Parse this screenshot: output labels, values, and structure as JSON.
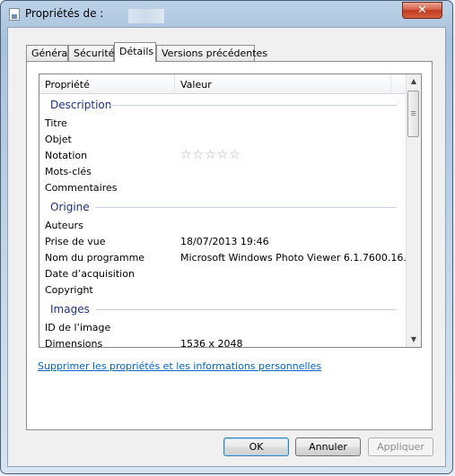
{
  "window": {
    "title": "Propriétés de :"
  },
  "tabs": [
    {
      "label": "Général"
    },
    {
      "label": "Sécurité"
    },
    {
      "label": "Détails"
    },
    {
      "label": "Versions précédentes"
    }
  ],
  "list": {
    "header": {
      "col_property": "Propriété",
      "col_value": "Valeur"
    },
    "groups": {
      "description": "Description",
      "origine": "Origine",
      "images": "Images"
    },
    "rows": {
      "titre": {
        "label": "Titre",
        "value": ""
      },
      "objet": {
        "label": "Objet",
        "value": ""
      },
      "notation": {
        "label": "Notation",
        "stars": "☆☆☆☆☆",
        "rating": 0,
        "max": 5
      },
      "mots_cles": {
        "label": "Mots-clés",
        "value": ""
      },
      "commentaires": {
        "label": "Commentaires",
        "value": ""
      },
      "auteurs": {
        "label": "Auteurs",
        "value": ""
      },
      "prise_de_vue": {
        "label": "Prise de vue",
        "value": "18/07/2013 19:46"
      },
      "nom_programme": {
        "label": "Nom du programme",
        "value": "Microsoft Windows Photo Viewer 6.1.7600.16..."
      },
      "date_acquisition": {
        "label": "Date d’acquisition",
        "value": ""
      },
      "copyright": {
        "label": "Copyright",
        "value": ""
      },
      "id_image": {
        "label": "ID de l’image",
        "value": ""
      },
      "dimensions": {
        "label": "Dimensions",
        "value": "1536 x 2048"
      }
    }
  },
  "link": {
    "label": "Supprimer les propriétés et les informations personnelles"
  },
  "buttons": {
    "ok": "OK",
    "annuler": "Annuler",
    "appliquer": "Appliquer"
  },
  "icons": {
    "close": "close-icon",
    "app": "file-properties-icon",
    "scroll_up": "scroll-up-arrow-icon",
    "scroll_down": "scroll-down-arrow-icon"
  }
}
